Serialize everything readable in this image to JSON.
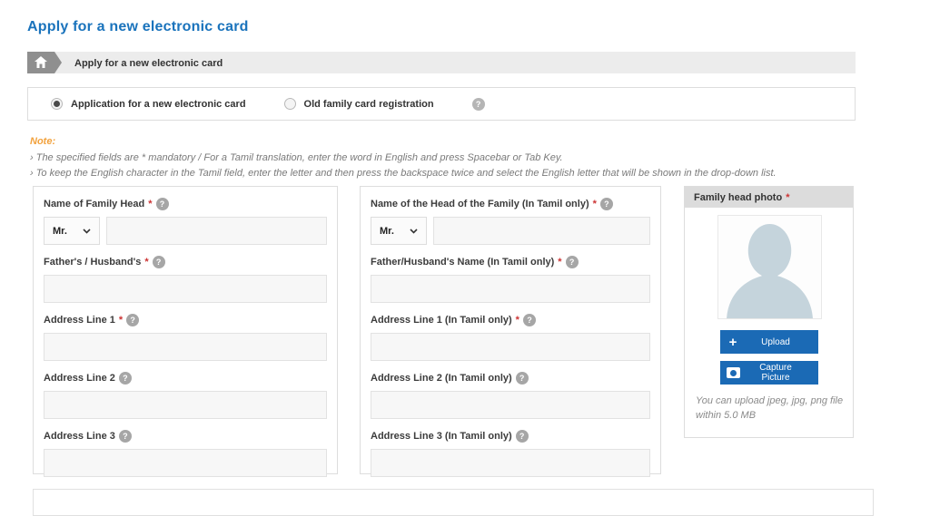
{
  "page": {
    "title": "Apply for a new electronic card"
  },
  "breadcrumb": {
    "label": "Apply for a new electronic card"
  },
  "mode": {
    "option_new": "Application for a new electronic card",
    "option_old": "Old family card registration"
  },
  "note": {
    "heading": "Note:",
    "line1": "› The specified fields are  * mandatory /  For a Tamil translation, enter the word in English and press Spacebar or Tab Key.",
    "line2": "› To keep the English character in the Tamil field, enter the letter and then press the backspace twice and select the English letter that will be shown in the drop-down list."
  },
  "fields": {
    "en_name": {
      "label": "Name of Family Head"
    },
    "en_father": {
      "label": "Father's / Husband's"
    },
    "en_addr1": {
      "label": "Address Line 1"
    },
    "en_addr2": {
      "label": "Address Line 2"
    },
    "en_addr3": {
      "label": "Address Line 3"
    },
    "ta_name": {
      "label": "Name of the Head of the Family (In Tamil only)"
    },
    "ta_father": {
      "label": "Father/Husband's Name (In Tamil only)"
    },
    "ta_addr1": {
      "label": "Address Line 1 (In Tamil only)"
    },
    "ta_addr2": {
      "label": "Address Line 2 (In Tamil only)"
    },
    "ta_addr3": {
      "label": "Address Line 3 (In Tamil only)"
    }
  },
  "title_select": {
    "value": "Mr."
  },
  "photo": {
    "header": "Family head photo",
    "upload_label": "Upload",
    "capture_label": "Capture Picture",
    "hint": "You can upload jpeg, jpg, png file within 5.0 MB"
  },
  "symbols": {
    "required": "*",
    "help": "?"
  },
  "colors": {
    "title_blue": "#1a73bc",
    "button_blue": "#1b6ab5",
    "note_orange": "#f2a13c",
    "required_red": "#cc3333",
    "silhouette": "#c5d4dc"
  }
}
